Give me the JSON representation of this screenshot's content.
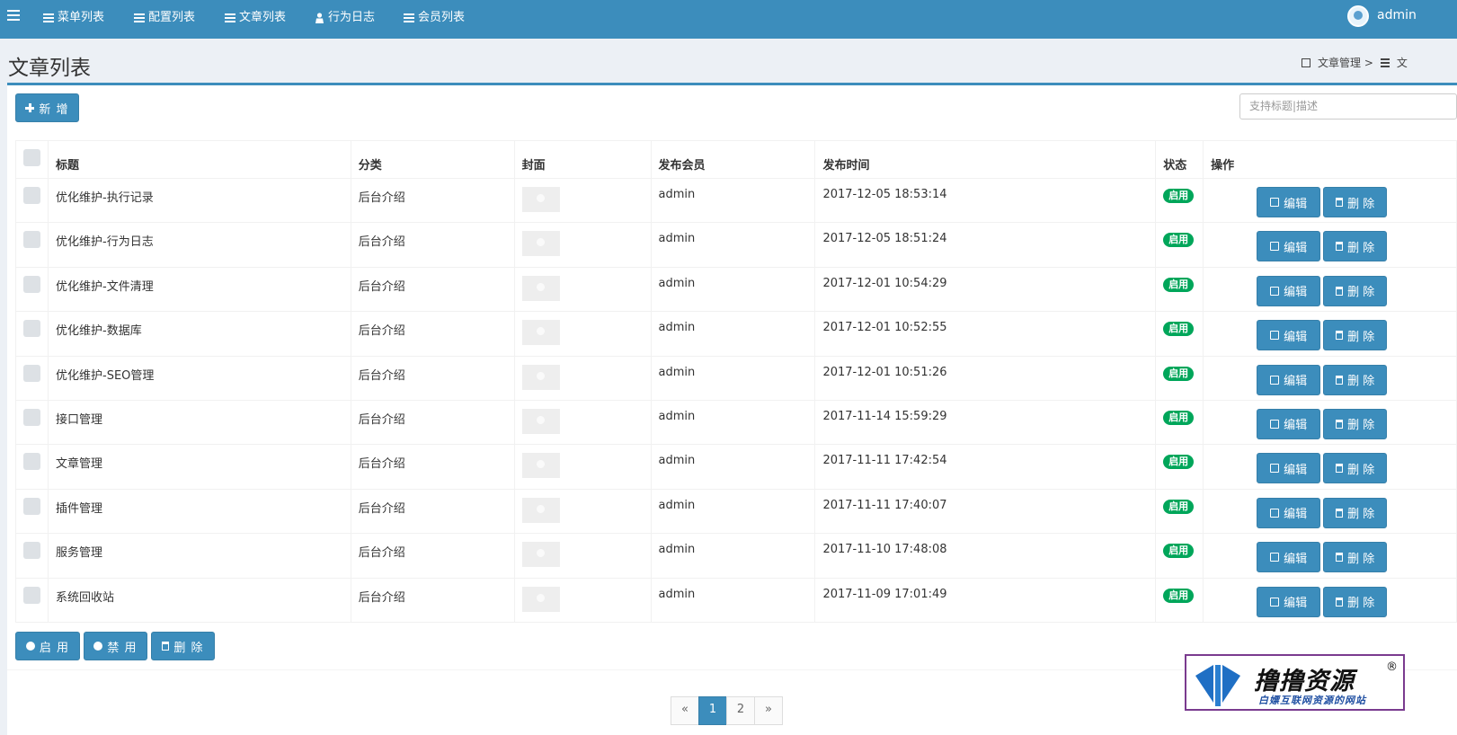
{
  "nav": {
    "items": [
      {
        "label": "菜单列表",
        "icon": "list-icon"
      },
      {
        "label": "配置列表",
        "icon": "list-icon"
      },
      {
        "label": "文章列表",
        "icon": "list-icon"
      },
      {
        "label": "行为日志",
        "icon": "user-icon"
      },
      {
        "label": "会员列表",
        "icon": "list-icon"
      }
    ],
    "user": "admin"
  },
  "header": {
    "title": "文章列表",
    "breadcrumb": [
      "文章管理 >",
      "文"
    ]
  },
  "toolbar": {
    "add_label": "新 增",
    "search_placeholder": "支持标题|描述"
  },
  "table": {
    "columns": [
      "标题",
      "分类",
      "封面",
      "发布会员",
      "发布时间",
      "状态",
      "操作"
    ],
    "rows": [
      {
        "title": "优化维护-执行记录",
        "category": "后台介绍",
        "member": "admin",
        "time": "2017-12-05 18:53:14",
        "status": "启用"
      },
      {
        "title": "优化维护-行为日志",
        "category": "后台介绍",
        "member": "admin",
        "time": "2017-12-05 18:51:24",
        "status": "启用"
      },
      {
        "title": "优化维护-文件清理",
        "category": "后台介绍",
        "member": "admin",
        "time": "2017-12-01 10:54:29",
        "status": "启用"
      },
      {
        "title": "优化维护-数据库",
        "category": "后台介绍",
        "member": "admin",
        "time": "2017-12-01 10:52:55",
        "status": "启用"
      },
      {
        "title": "优化维护-SEO管理",
        "category": "后台介绍",
        "member": "admin",
        "time": "2017-12-01 10:51:26",
        "status": "启用"
      },
      {
        "title": "接口管理",
        "category": "后台介绍",
        "member": "admin",
        "time": "2017-11-14 15:59:29",
        "status": "启用"
      },
      {
        "title": "文章管理",
        "category": "后台介绍",
        "member": "admin",
        "time": "2017-11-11 17:42:54",
        "status": "启用"
      },
      {
        "title": "插件管理",
        "category": "后台介绍",
        "member": "admin",
        "time": "2017-11-11 17:40:07",
        "status": "启用"
      },
      {
        "title": "服务管理",
        "category": "后台介绍",
        "member": "admin",
        "time": "2017-11-10 17:48:08",
        "status": "启用"
      },
      {
        "title": "系统回收站",
        "category": "后台介绍",
        "member": "admin",
        "time": "2017-11-09 17:01:49",
        "status": "启用"
      }
    ],
    "edit_label": "编辑",
    "delete_label": "删 除"
  },
  "bulk": {
    "enable_label": "启 用",
    "disable_label": "禁 用",
    "delete_label": "删 除"
  },
  "pagination": [
    "«",
    "1",
    "2",
    "»"
  ],
  "pagination_active": "1",
  "watermark": {
    "title": "撸撸资源",
    "reg": "®",
    "subtitle": "白嫖互联网资源的网站"
  },
  "colors": {
    "primary": "#3c8dbc",
    "success": "#00a65a"
  }
}
